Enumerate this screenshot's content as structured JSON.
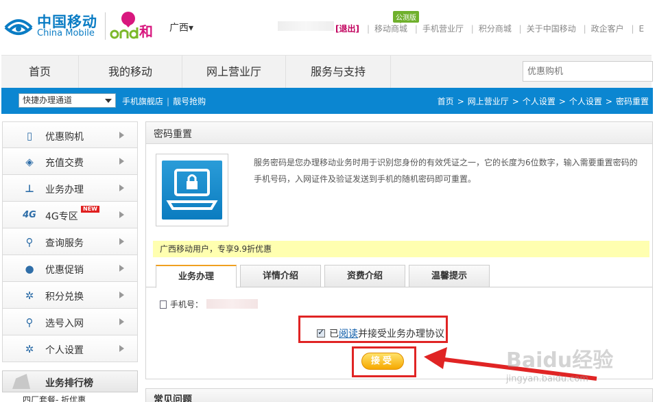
{
  "header": {
    "logo_cn": "中国移动",
    "logo_en": "China Mobile",
    "brand_and": "and",
    "brand_he": "和",
    "region": "广西",
    "logout": "[退出]",
    "beta_badge": "公测版",
    "links": [
      "移动商城",
      "手机营业厅",
      "积分商城",
      "关于中国移动",
      "政企客户",
      "E"
    ]
  },
  "nav": {
    "items": [
      "首页",
      "我的移动",
      "网上营业厅",
      "服务与支持"
    ],
    "search_placeholder": "优惠购机"
  },
  "bluebar": {
    "quick_select": "快捷办理通道",
    "links": [
      "手机旗舰店",
      "靓号抢购"
    ],
    "breadcrumb": [
      "首页",
      "网上营业厅",
      "个人设置",
      "个人设置",
      "密码重置"
    ]
  },
  "sidebar": {
    "items": [
      {
        "label": "优惠购机",
        "icon": "phone-icon"
      },
      {
        "label": "充值交费",
        "icon": "card-icon"
      },
      {
        "label": "业务办理",
        "icon": "tree-icon"
      },
      {
        "label": "4G专区",
        "icon": "4g-icon",
        "badge": "NEW"
      },
      {
        "label": "查询服务",
        "icon": "search-person-icon"
      },
      {
        "label": "优惠促销",
        "icon": "tag-icon"
      },
      {
        "label": "积分兑换",
        "icon": "gear-icon"
      },
      {
        "label": "选号入网",
        "icon": "person-icon"
      },
      {
        "label": "个人设置",
        "icon": "gear-icon"
      }
    ],
    "ranking_title": "业务排行榜",
    "ranking_first": "四厂套餐- 折优惠"
  },
  "panel": {
    "title": "密码重置",
    "description": "服务密码是您办理移动业务时用于识别您身份的有效凭证之一，它的长度为6位数字，输入需要重置密码的手机号码，入网证件及验证发送到手机的随机密码即可重置。",
    "promo": "广西移动用户，专享9.9折优惠",
    "tabs": [
      "业务办理",
      "详情介绍",
      "资费介绍",
      "温馨提示"
    ],
    "active_tab": "业务办理",
    "phone_label": "手机号：",
    "agree_prefix": "已",
    "agree_link": "阅读",
    "agree_suffix": "并接受业务办理协议",
    "agree_checked": true,
    "accept_button": "接受"
  },
  "faq": {
    "title": "常见问题"
  },
  "watermark": {
    "main": "Baidu经验",
    "sub": "jingyan.baidu.com"
  },
  "colors": {
    "brand_blue": "#0b86d1",
    "annotation_red": "#e02424",
    "accept_orange": "#f6a800",
    "promo_yellow": "#ffffb0"
  }
}
